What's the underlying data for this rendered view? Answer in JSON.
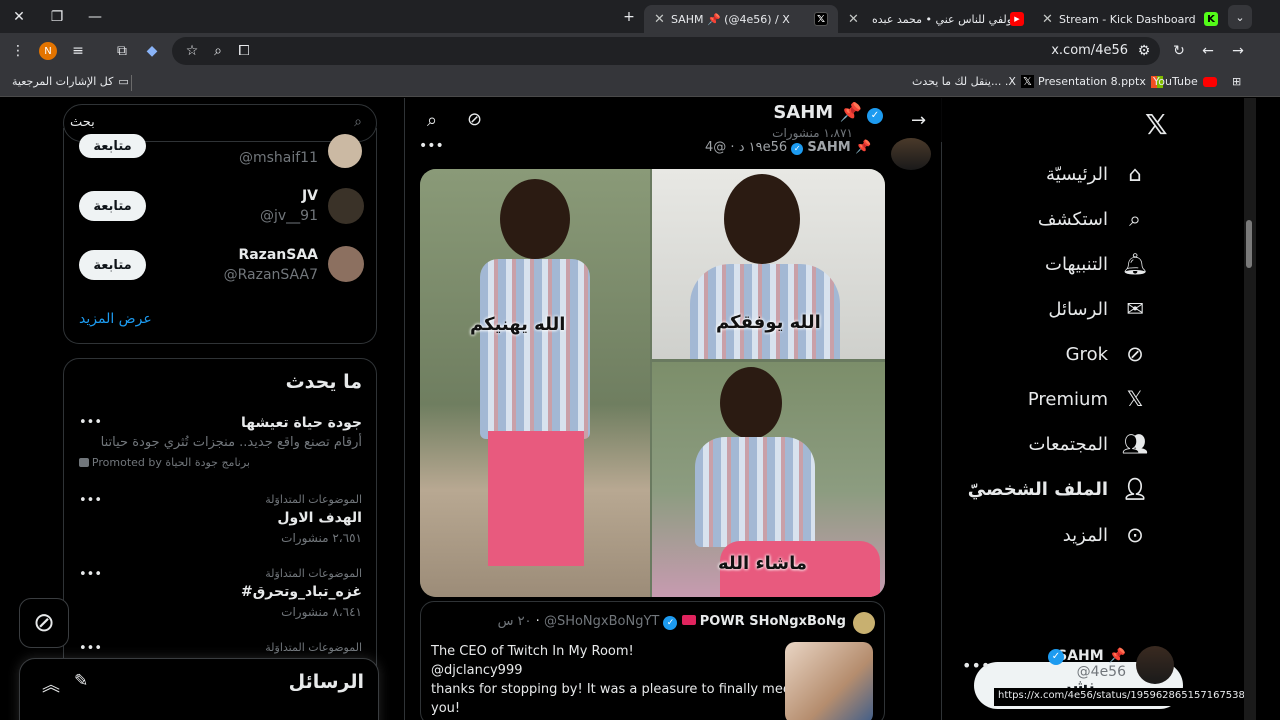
{
  "browser": {
    "tabs": [
      {
        "title": "SAHM 📌 (@4e56) / X",
        "active": true
      },
      {
        "title": "سولفي للناس عني • محمد عبده",
        "active": false
      },
      {
        "title": "Stream - Kick Dashboard",
        "active": false
      }
    ],
    "url": "x.com/4e56",
    "profile_initial": "N",
    "bookmarks": [
      {
        "label": "YouTube"
      },
      {
        "label": "Presentation 8.pptx"
      },
      {
        "label": "ينقل لك ما يحدث... .X"
      }
    ],
    "all_bookmarks": "كل الإشارات المرجعية",
    "status_url": "https://x.com/4e56/status/1959628651571675383/photo/1"
  },
  "nav": {
    "items": [
      {
        "label": "الرئيسيّة",
        "icon": "home-icon"
      },
      {
        "label": "استكشف",
        "icon": "search-icon"
      },
      {
        "label": "التنبيهات",
        "icon": "bell-icon"
      },
      {
        "label": "الرسائل",
        "icon": "mail-icon"
      },
      {
        "label": "Grok",
        "icon": "grok-icon"
      },
      {
        "label": "Premium",
        "icon": "x-logo-icon"
      },
      {
        "label": "المجتمعات",
        "icon": "communities-icon"
      },
      {
        "label": "الملف الشخصيّ",
        "icon": "person-icon"
      },
      {
        "label": "المزيد",
        "icon": "more-circle-icon"
      }
    ],
    "post_label": "نشر",
    "account_name": "SAHM 📌",
    "account_handle": "@4e56"
  },
  "profile_header": {
    "name": "SAHM 📌",
    "posts_count": "١،٨٧١ منشورات"
  },
  "tweet": {
    "author": "SAHM 📌",
    "handle": "@4e56",
    "time": "١٩ د",
    "image_captions": [
      "الله يوفقكم",
      "الله يهنيكم",
      "ماشاء الله"
    ]
  },
  "quoted_tweet": {
    "author": "POWR SHoNgxBoNg",
    "handle": "@SHoNgxBoNgYT",
    "time": "٢٠ س",
    "line1": "The CEO of Twitch In My Room!",
    "line2": "@djclancy999",
    "line3": "thanks for stopping by! It was a pleasure to finally meet",
    "line4": "you!"
  },
  "search": {
    "placeholder": "بحث"
  },
  "who_to_follow": {
    "users": [
      {
        "name": "",
        "handle": "@mshaif11",
        "button": "متابعة"
      },
      {
        "name": "JV",
        "handle": "@jv__91",
        "button": "متابعة"
      },
      {
        "name": "RazanSAA",
        "handle": "@RazanSAA7",
        "button": "متابعة"
      }
    ],
    "show_more": "عرض المزيد"
  },
  "whats_happening": {
    "title": "ما يحدث",
    "promoted": {
      "title": "جودة حياة تعيشها",
      "desc": "أرقام تصنع واقع جديد.. منجزات تُثري جودة حياتنا",
      "by": "Promoted by برنامج جودة الحياة"
    },
    "trends": [
      {
        "context": "الموضوعات المتداوَلة",
        "name": "الهدف الاول",
        "count": "٢،٦٥١ منشورات"
      },
      {
        "context": "الموضوعات المتداوَلة",
        "name": "#غزه_تباد_وتحرق",
        "count": "٨،٦٤١ منشورات"
      },
      {
        "context": "الموضوعات المتداوَلة",
        "name": "",
        "count": ""
      }
    ]
  },
  "messages_drawer": {
    "title": "الرسائل"
  },
  "colors": {
    "accent": "#1d9bf0",
    "background": "#000000",
    "border": "#2f3336"
  }
}
